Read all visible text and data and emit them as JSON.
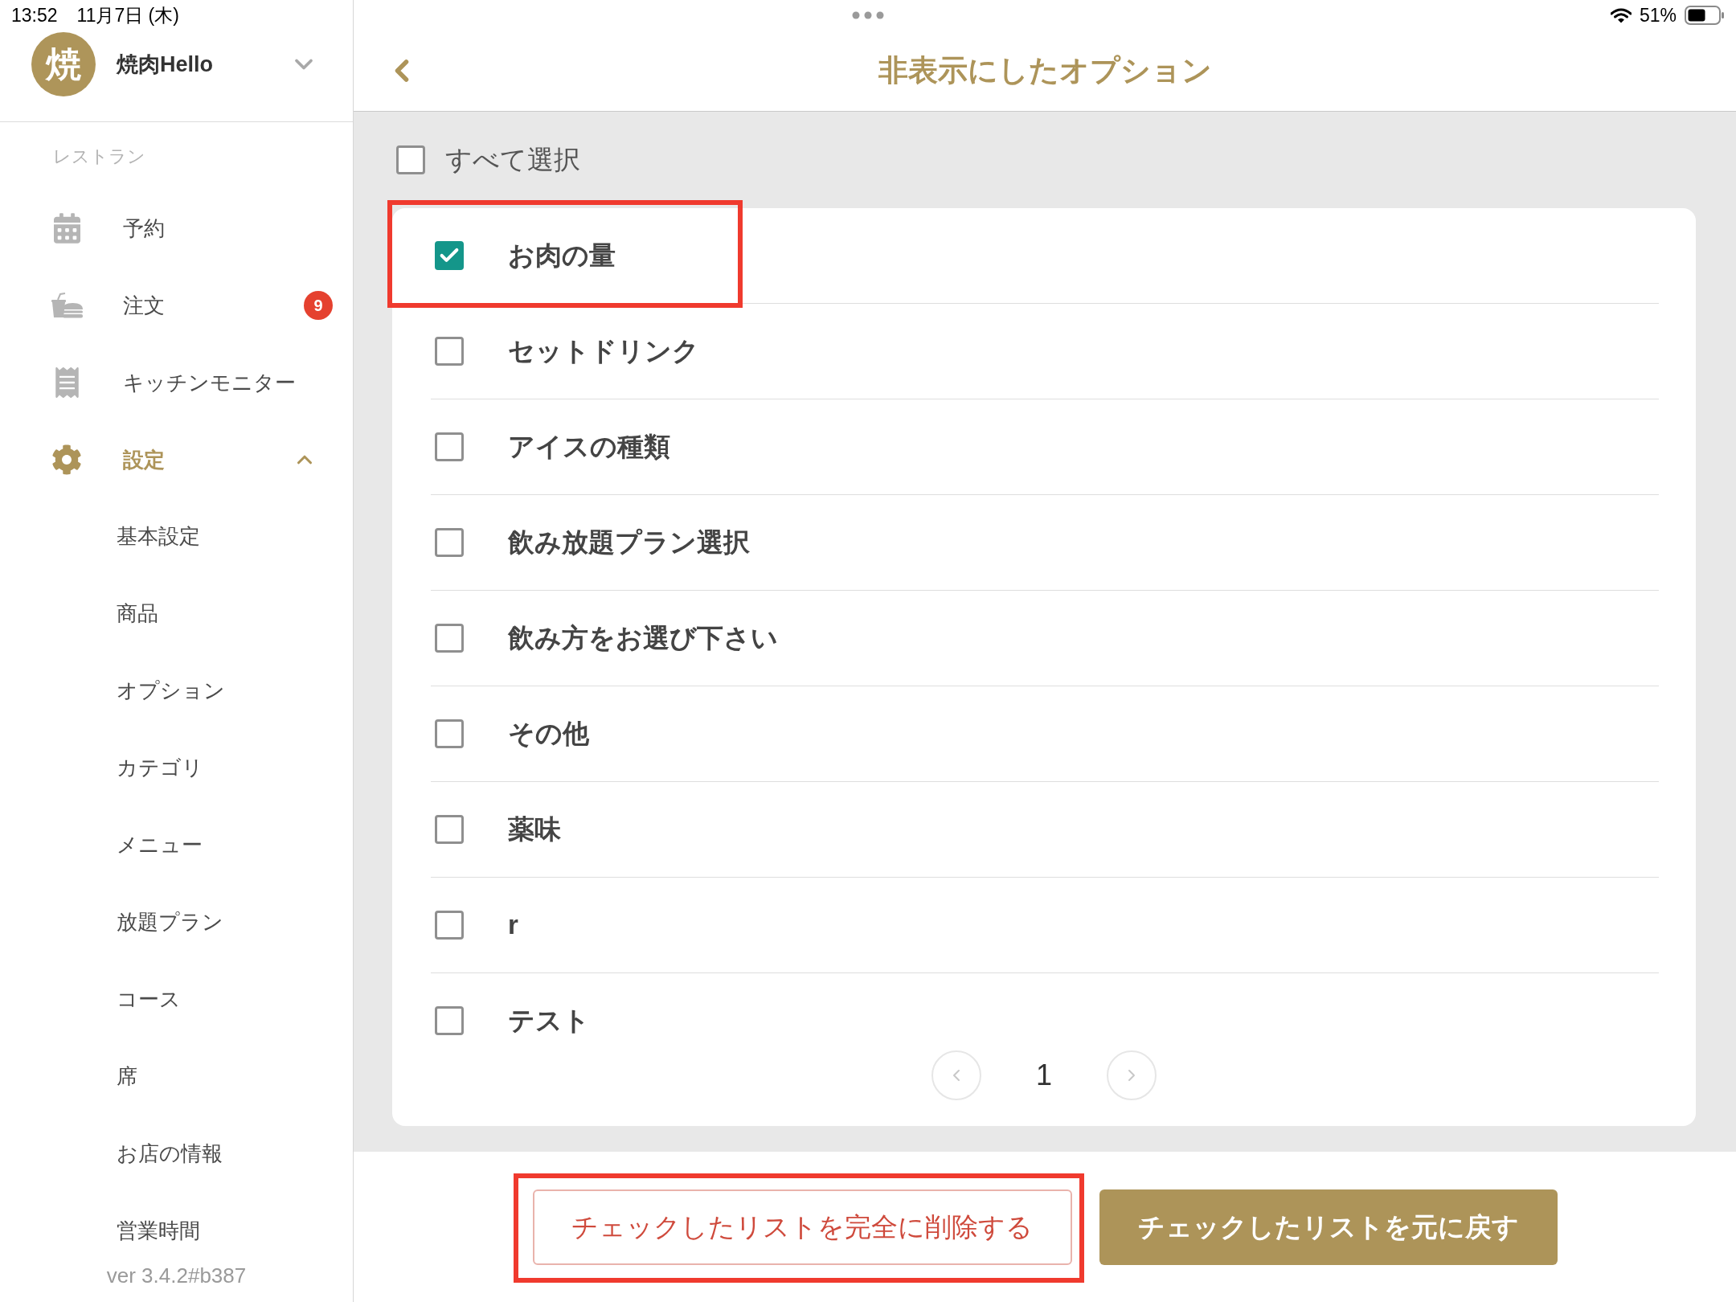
{
  "status_bar": {
    "time": "13:52",
    "date": "11月7日 (木)",
    "battery": "51%"
  },
  "sidebar": {
    "avatar": "焼",
    "name": "焼肉Hello",
    "section": "レストラン",
    "items": [
      {
        "label": "予約",
        "selected": false
      },
      {
        "label": "注文",
        "selected": false,
        "badge": "9"
      },
      {
        "label": "キッチンモニター",
        "selected": false
      },
      {
        "label": "設定",
        "selected": true,
        "expanded": true,
        "children": [
          {
            "label": "基本設定"
          },
          {
            "label": "商品"
          },
          {
            "label": "オプション"
          },
          {
            "label": "カテゴリ"
          },
          {
            "label": "メニュー"
          },
          {
            "label": "放題プラン"
          },
          {
            "label": "コース"
          },
          {
            "label": "席"
          },
          {
            "label": "お店の情報"
          },
          {
            "label": "営業時間"
          }
        ]
      }
    ],
    "version": "ver 3.4.2#b387"
  },
  "header": {
    "title": "非表示にしたオプション"
  },
  "select_all": {
    "label": "すべて選択",
    "checked": false
  },
  "options": [
    {
      "label": "お肉の量",
      "checked": true,
      "highlighted": true
    },
    {
      "label": "セットドリンク",
      "checked": false,
      "highlighted": false
    },
    {
      "label": "アイスの種類",
      "checked": false,
      "highlighted": false
    },
    {
      "label": "飲み放題プラン選択",
      "checked": false,
      "highlighted": false
    },
    {
      "label": "飲み方をお選び下さい",
      "checked": false,
      "highlighted": false
    },
    {
      "label": "その他",
      "checked": false,
      "highlighted": false
    },
    {
      "label": "薬味",
      "checked": false,
      "highlighted": false
    },
    {
      "label": "r",
      "checked": false,
      "highlighted": false
    },
    {
      "label": "テスト",
      "checked": false,
      "highlighted": false
    }
  ],
  "pagination": {
    "prev_disabled": true,
    "pages": [
      {
        "label": "1",
        "selected": true
      }
    ],
    "next_disabled": true
  },
  "footer_buttons": [
    {
      "label": "チェックしたリストを完全に削除する",
      "kind": "outline",
      "highlighted": true
    },
    {
      "label": "チェックしたリストを元に戻す",
      "kind": "filled",
      "highlighted": false
    }
  ]
}
